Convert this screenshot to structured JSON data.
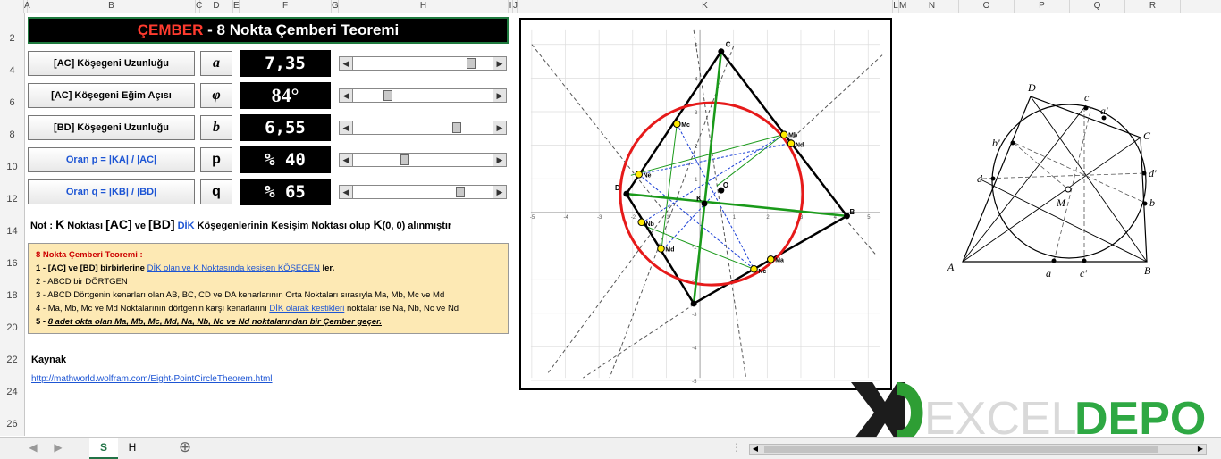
{
  "sheet": {
    "columns": [
      "A",
      "B",
      "C",
      "D",
      "E",
      "F",
      "G",
      "H",
      "I",
      "J",
      "K",
      "L",
      "M",
      "N",
      "O",
      "P",
      "Q",
      "R"
    ],
    "rows": [
      "2",
      "4",
      "6",
      "8",
      "10",
      "12",
      "14",
      "16",
      "18",
      "20",
      "22",
      "24",
      "26"
    ]
  },
  "title": {
    "part1": "ÇEMBER",
    "part2": " - 8 Nokta Çemberi Teoremi"
  },
  "params": [
    {
      "label": "[AC]  Köşegeni Uzunluğu",
      "symbol": "a",
      "value": "7,35",
      "slider": 0.86
    },
    {
      "label": "[AC]  Köşegeni Eğim Açısı",
      "symbol": "φ",
      "value": "84°",
      "slider": 0.23
    },
    {
      "label": "[BD]  Köşegeni Uzunluğu",
      "symbol": "b",
      "value": "6,55",
      "slider": 0.75
    },
    {
      "label": "Oran   p = |KA| / |AC|",
      "symbol": "p",
      "value": "% 40",
      "slider": 0.36
    },
    {
      "label": "Oran   q = |KB| / |BD|",
      "symbol": "q",
      "value": "% 65",
      "slider": 0.78
    }
  ],
  "note": {
    "p1": "Not : ",
    "k1": "K",
    "p2": " Noktası ",
    "ac": "[AC]",
    "p3": " ve ",
    "bd": "[BD]",
    "dik": " DİK",
    "p4": " Köşegenlerinin Kesişim Noktası olup ",
    "k2": "K",
    "p5": "(0, 0) alınmıştır"
  },
  "info": {
    "title": "8 Nokta Çemberi Teoremi :",
    "l1a": "1 - [AC] ve [BD] birbirlerine ",
    "l1link": "DİK olan ve K Noktasında kesişen KÖŞEGEN",
    "l1b": " ler.",
    "l2": "2 - ABCD bir DÖRTGEN",
    "l3": "3 - ABCD Dörtgenin kenarları olan AB, BC, CD ve DA kenarlarının Orta Noktaları sırasıyla Ma, Mb, Mc ve Md",
    "l4a": "4 - Ma, Mb, Mc ve Md Noktalarının dörtgenin karşı kenarlarını ",
    "l4link": "DİK olarak kestikleri",
    "l4b": " noktalar ise Na, Nb, Nc ve Nd",
    "l5a": "5 - ",
    "l5": "8 adet okta olan Ma, Mb, Mc, Md, Na, Nb, Nc ve Nd noktalarından bir Çember geçer."
  },
  "source": {
    "heading": "Kaynak",
    "url": "http://mathworld.wolfram.com/Eight-PointCircleTheorem.html"
  },
  "plot": {
    "points": [
      "C",
      "D",
      "B",
      "K",
      "O",
      "Mc",
      "Mb",
      "Nd",
      "Ne",
      "Nb",
      "Md",
      "Ma",
      "Nc"
    ],
    "ticks_x": [
      "-5",
      "-4",
      "-3",
      "-2",
      "-1",
      "1",
      "2",
      "3",
      "4",
      "5"
    ],
    "ticks_y": [
      "5",
      "4",
      "3",
      "2",
      "1",
      "-1",
      "-2",
      "-3",
      "-4",
      "-5"
    ],
    "colors": {
      "circle": "#e61a1a",
      "quad": "#000000",
      "diag": "#1a9a1a",
      "dash": "#1a3fd6"
    }
  },
  "reference": {
    "labels": [
      "D",
      "c",
      "a'",
      "C",
      "b'",
      "d",
      "d'",
      "M",
      "b",
      "A",
      "a",
      "c'",
      "B"
    ]
  },
  "logo": {
    "left": "EXCEL",
    "right": "DEPO"
  },
  "tabs": [
    {
      "label": "S",
      "active": true
    },
    {
      "label": "H",
      "active": false
    }
  ],
  "add_sheet": "⊕"
}
